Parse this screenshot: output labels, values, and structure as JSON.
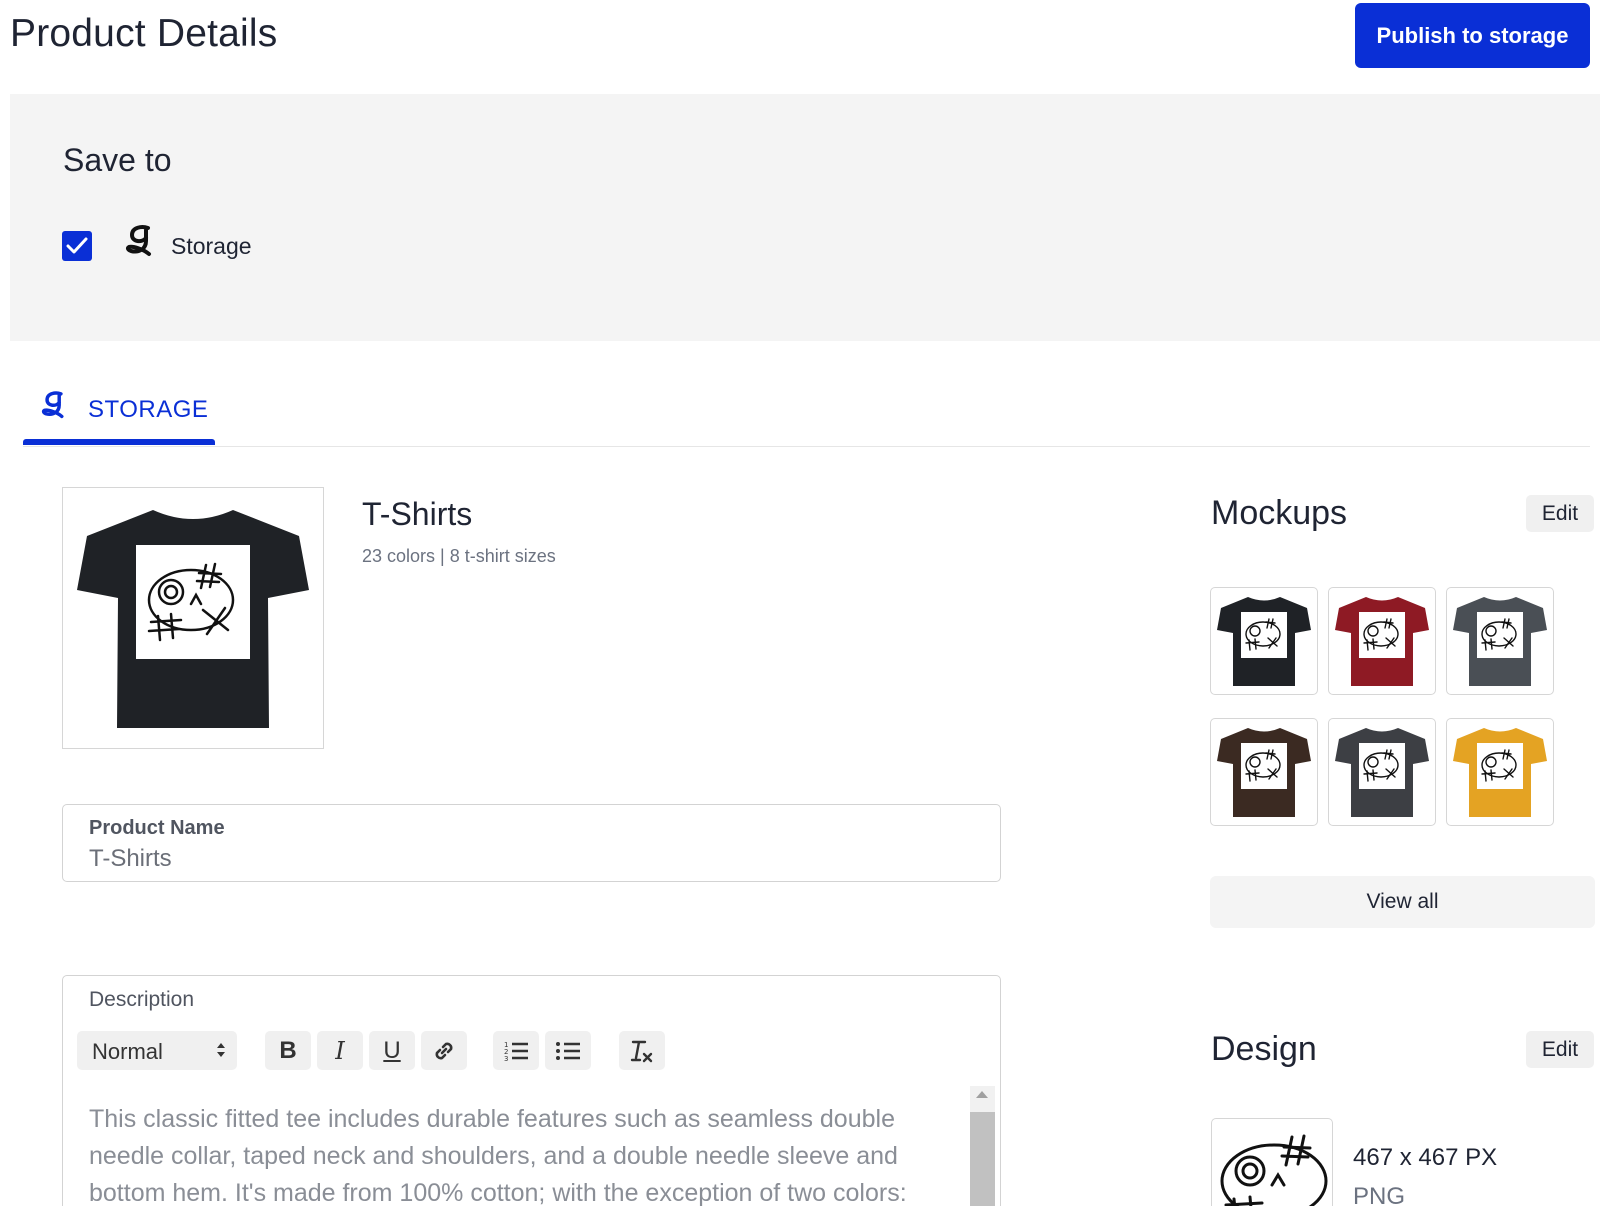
{
  "header": {
    "title": "Product Details",
    "publish_label": "Publish to storage"
  },
  "save_to": {
    "title": "Save to",
    "checked": true,
    "option_label": "Storage"
  },
  "tabs": [
    {
      "label": "STORAGE",
      "active": true
    }
  ],
  "product": {
    "title": "T-Shirts",
    "meta": "23 colors | 8 t-shirt sizes",
    "shirt_color": "#1f2226"
  },
  "fields": {
    "product_name_label": "Product Name",
    "product_name_value": "T-Shirts",
    "description_label": "Description",
    "format_value": "Normal",
    "toolbar": [
      {
        "name": "bold",
        "glyph": "B"
      },
      {
        "name": "italic",
        "glyph": "I"
      },
      {
        "name": "underline",
        "glyph": "U"
      },
      {
        "name": "link",
        "glyph": "link"
      },
      {
        "name": "ordered-list",
        "glyph": "ol"
      },
      {
        "name": "bullet-list",
        "glyph": "ul"
      },
      {
        "name": "clear-format",
        "glyph": "Tx"
      }
    ],
    "description_text": "This classic fitted tee includes durable features such as seamless double needle collar, taped neck and shoulders, and a double needle sleeve and bottom hem. It's made from 100% cotton; with the exception of two colors:"
  },
  "mockups": {
    "title": "Mockups",
    "edit_label": "Edit",
    "items": [
      {
        "color": "#1f2226"
      },
      {
        "color": "#8e1a24"
      },
      {
        "color": "#4a4f55"
      },
      {
        "color": "#3b2a22"
      },
      {
        "color": "#3d3f44"
      },
      {
        "color": "#e4a323"
      }
    ],
    "view_all_label": "View all"
  },
  "design": {
    "title": "Design",
    "edit_label": "Edit",
    "dimensions": "467 x 467 PX",
    "format": "PNG"
  },
  "colors": {
    "accent": "#0a2fd6",
    "panel": "#f4f4f4"
  }
}
